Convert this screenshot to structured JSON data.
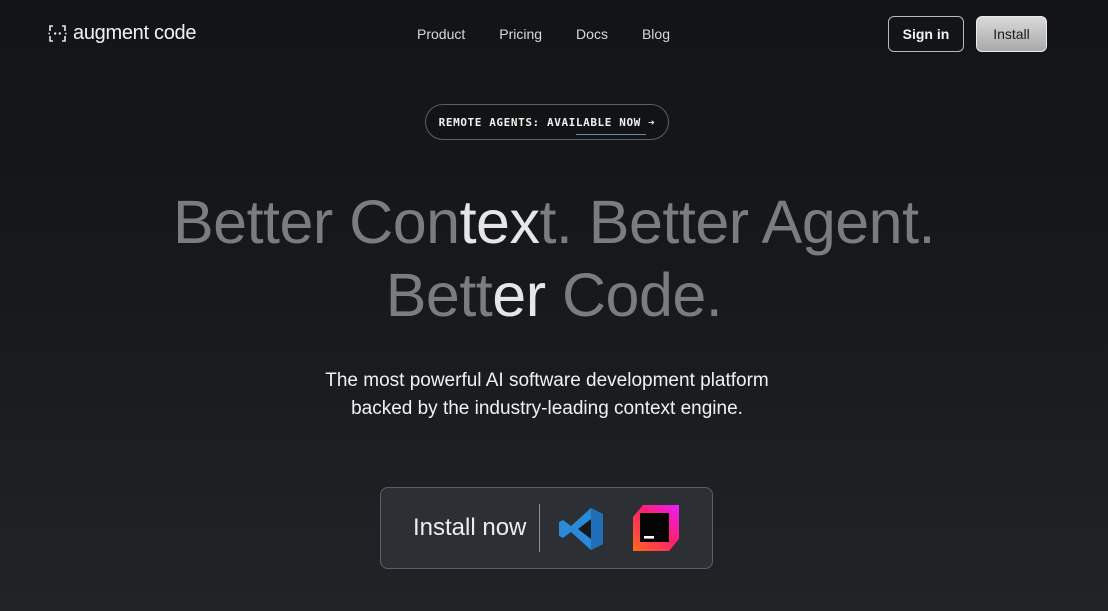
{
  "nav": {
    "logo_text": "augment code",
    "links": [
      "Product",
      "Pricing",
      "Docs",
      "Blog"
    ],
    "signin_label": "Sign in",
    "install_label": "Install"
  },
  "announcement": {
    "text": "REMOTE AGENTS: AVAILABLE NOW ➔"
  },
  "hero": {
    "line1_pre": "Better Con",
    "line1_bright": "tex",
    "line1_post": "t. Better Agent.",
    "line2_pre": "Bett",
    "line2_bright": "er",
    "line2_post": " Code.",
    "subtitle_line1": "The most powerful AI software development platform",
    "subtitle_line2": "backed by the industry-leading context engine."
  },
  "install_card": {
    "label": "Install now",
    "icons": [
      "vscode-icon",
      "jetbrains-icon"
    ]
  },
  "colors": {
    "background": "#16191c",
    "headline_dim": "#7a7c7f",
    "headline_bright": "#e6e6e6",
    "vscode_blue": "#2b8ad8",
    "jetbrains_magenta": "#ff1f8e",
    "jetbrains_orange": "#ff6a1a"
  }
}
